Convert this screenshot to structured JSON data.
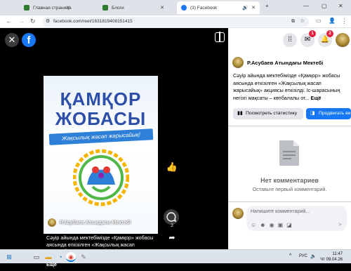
{
  "browser": {
    "tabs": [
      {
        "label": "Главная страница",
        "active": false,
        "color": "#2e7d32"
      },
      {
        "label": "Блоги",
        "active": false,
        "color": "#2e7d32"
      },
      {
        "label": "(3) Facebook",
        "active": true,
        "color": "#1877f2"
      }
    ],
    "url": "facebook.com/reel/1631819408151415"
  },
  "reel": {
    "poster_line1": "ҚАМҚОР",
    "poster_line2": "ЖОБАСЫ",
    "poster_ribbon": "Жақсылық жасап жарысайық!",
    "author": "Р.Асубаев Атындағы Мектебі",
    "caption": "Сәуір айында мектебімізде «Қамқор» жобасы аясында өткізілген «Жақсылық жасап жарысайық» акциясы өткізілді. Іс-шарасының негізгі мақсаты – көпбалалы от...",
    "caption_more": "Ещё",
    "comment_count": "2"
  },
  "panel": {
    "messenger_badge": "1",
    "notifications_badge": "2",
    "author": "Р.Асубаев Атындағы Мектебі",
    "post_text": "Сәуір айында мектебімізде «Қамқор» жобасы аясында өткізілген «Жақсылық жасап жарысайық» акциясы өткізілді. Іс-шарасының негізгі мақсаты – көпбалалы от...",
    "post_more": "Ещё",
    "stats_button": "Посмотреть статистику",
    "promote_button": "Продвигать ви",
    "no_comments_title": "Нет комментариев",
    "no_comments_sub": "Оставьте первый комментарий.",
    "comment_placeholder": "Напишите комментарий..."
  },
  "taskbar": {
    "lang": "РУС",
    "time": "11:47",
    "date": "Чт 09.04.26"
  }
}
